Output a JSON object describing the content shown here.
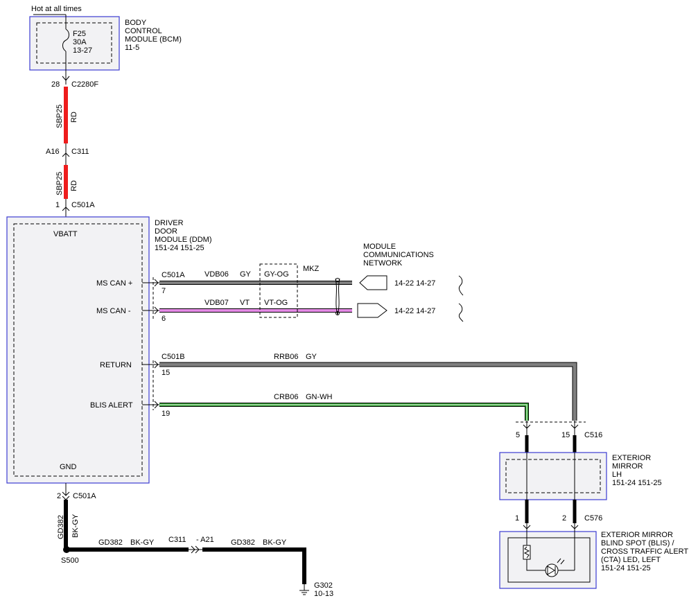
{
  "hot_label": "Hot at all times",
  "bcm": {
    "title": [
      "BODY",
      "CONTROL",
      "MODULE (BCM)",
      "11-5"
    ],
    "fuse": [
      "F25",
      "30A",
      "13-27"
    ]
  },
  "connectors": {
    "c2280f": {
      "pin": "28",
      "name": "C2280F"
    },
    "c311_top": {
      "pin": "A16",
      "name": "C311"
    },
    "c501a_top": {
      "pin": "1",
      "name": "C501A"
    },
    "c501a_can": {
      "name": "C501A",
      "pin_plus": "7",
      "pin_minus": "6"
    },
    "c501b": {
      "name": "C501B",
      "pin_return": "15",
      "pin_blis": "19"
    },
    "c501a_gnd": {
      "pin": "2",
      "name": "C501A"
    },
    "c516": {
      "pin_left": "5",
      "pin_right": "15",
      "name": "C516"
    },
    "c576": {
      "pin_left": "1",
      "pin_right": "2",
      "name": "C576"
    },
    "c311_bottom": {
      "name": "C311",
      "pin": "- A21"
    }
  },
  "wires": {
    "sbp25_1": {
      "circuit": "SBP25",
      "color": "RD"
    },
    "sbp25_2": {
      "circuit": "SBP25",
      "color": "RD"
    },
    "vdb06": {
      "circuit": "VDB06",
      "color": "GY",
      "alt": "GY-OG"
    },
    "vdb07": {
      "circuit": "VDB07",
      "color": "VT",
      "alt": "VT-OG"
    },
    "mkz": "MKZ",
    "rrb06": {
      "circuit": "RRB06",
      "color": "GY"
    },
    "crb06": {
      "circuit": "CRB06",
      "color": "GN-WH"
    },
    "gd382_v": {
      "circuit": "GD382",
      "color": "BK-GY"
    },
    "gd382_h1": {
      "circuit": "GD382",
      "color": "BK-GY"
    },
    "gd382_h2": {
      "circuit": "GD382",
      "color": "BK-GY"
    }
  },
  "ddm": {
    "title": [
      "DRIVER",
      "DOOR",
      "MODULE (DDM)",
      "151-24  151-25"
    ],
    "pins": {
      "vbatt": "VBATT",
      "ms_can_plus": "MS CAN +",
      "ms_can_minus": "MS CAN -",
      "return": "RETURN",
      "blis_alert": "BLIS ALERT",
      "gnd": "GND"
    }
  },
  "network": {
    "title": [
      "MODULE",
      "COMMUNICATIONS",
      "NETWORK"
    ],
    "refs_plus": "14-22   14-27",
    "refs_minus": "14-22   14-27"
  },
  "mirror": {
    "title": [
      "EXTERIOR",
      "MIRROR",
      "LH",
      "151-24  151-25"
    ]
  },
  "blis_led": {
    "title": [
      "EXTERIOR MIRROR",
      "BLIND SPOT (BLIS) /",
      "CROSS TRAFFIC ALERT",
      "(CTA) LED, LEFT",
      "151-24  151-25"
    ]
  },
  "splice": "S500",
  "ground": {
    "name": "G302",
    "ref": "10-13"
  },
  "colors": {
    "red": "#ee1c1c",
    "gray": "#808080",
    "violet": "#e48ae6",
    "green": "#2ca02c",
    "black": "#000000",
    "box_border": "#3b3bd1"
  }
}
